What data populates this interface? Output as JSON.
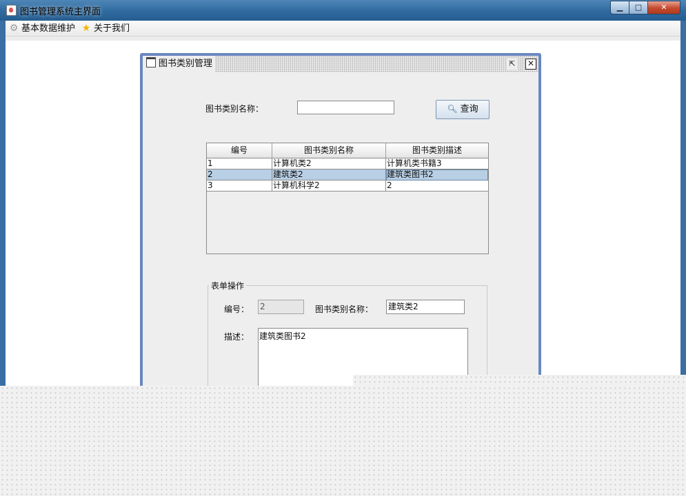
{
  "window": {
    "title": "图书管理系统主界面",
    "app_icon": "java-icon"
  },
  "menubar": {
    "items": [
      {
        "label": "基本数据维护",
        "icon": "gear-icon"
      },
      {
        "label": "关于我们",
        "icon": "star-icon"
      }
    ]
  },
  "internal_frame": {
    "title": "图书类别管理",
    "search": {
      "label": "图书类别名称：",
      "value": "",
      "button_label": "查询"
    },
    "table": {
      "columns": [
        "编号",
        "图书类别名称",
        "图书类别描述"
      ],
      "rows": [
        [
          "1",
          "计算机类2",
          "计算机类书籍3"
        ],
        [
          "2",
          "建筑类2",
          "建筑类图书2"
        ],
        [
          "3",
          "计算机科学2",
          "2"
        ]
      ],
      "selected_row": 1
    },
    "form": {
      "legend": "表单操作",
      "id_label": "编号：",
      "id_value": "2",
      "name_label": "图书类别名称：",
      "name_value": "建筑类2",
      "desc_label": "描述：",
      "desc_value": "建筑类图书2"
    }
  },
  "colors": {
    "selection": "#b8cfe5",
    "frame_border": "#6a87c0",
    "titlebar": "#2f6a9e"
  }
}
